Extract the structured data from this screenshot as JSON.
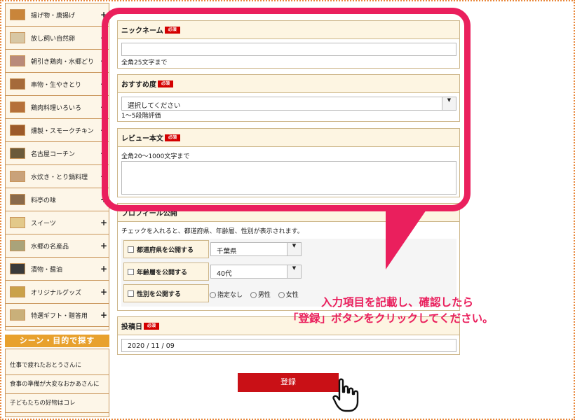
{
  "sidebar": {
    "categories": [
      {
        "label": "揚げ物・唐揚げ",
        "icon": "fried-chicken-thumb"
      },
      {
        "label": "放し飼い自然卵",
        "icon": "egg-thumb"
      },
      {
        "label": "朝引き鶏肉・水郷どり",
        "icon": "raw-chicken-thumb"
      },
      {
        "label": "串物・生やきとり",
        "icon": "skewer-thumb"
      },
      {
        "label": "鶏肉料理いろいろ",
        "icon": "chicken-dish-thumb"
      },
      {
        "label": "燻製・スモークチキン",
        "icon": "smoked-chicken-thumb"
      },
      {
        "label": "名古屋コーチン",
        "icon": "nagoya-cochin-thumb"
      },
      {
        "label": "水炊き・とり鍋料理",
        "icon": "hotpot-thumb"
      },
      {
        "label": "料亭の味",
        "icon": "ryotei-thumb"
      },
      {
        "label": "スイーツ",
        "icon": "sweets-thumb"
      },
      {
        "label": "水郷の名産品",
        "icon": "local-specialty-thumb"
      },
      {
        "label": "漬物・醤油",
        "icon": "pickles-thumb"
      },
      {
        "label": "オリジナルグッズ",
        "icon": "goods-thumb"
      },
      {
        "label": "特選ギフト・贈答用",
        "icon": "gift-thumb"
      }
    ],
    "scene_heading": "シーン・目的で探す",
    "scene_items": [
      "仕事で疲れたおとうさんに",
      "食事の準備が大変なおかあさんに",
      "子どもたちの好物はコレ"
    ]
  },
  "form": {
    "required_badge": "必須",
    "nickname": {
      "label": "ニックネーム",
      "value": "",
      "note": "全角25文字まで"
    },
    "rating": {
      "label": "おすすめ度",
      "selected": "選択してください",
      "note": "1～5段階評価"
    },
    "review": {
      "label": "レビュー本文",
      "note": "全角20～1000文字まで",
      "value": ""
    },
    "profile": {
      "label": "プロフィール公開",
      "description": "チェックを入れると、都道府県、年齢層、性別が表示されます。",
      "prefecture": {
        "label": "都道府県を公開する",
        "selected": "千葉県"
      },
      "age": {
        "label": "年齢層を公開する",
        "selected": "40代"
      },
      "gender": {
        "label": "性別を公開する",
        "options": [
          "指定なし",
          "男性",
          "女性"
        ]
      }
    },
    "post_date": {
      "label": "投稿日",
      "value": "2020 / 11 / 09"
    },
    "submit_label": "登録"
  },
  "annotation": {
    "line1": "入力項目を記載し、確認したら",
    "line2": "「登録」ボタンをクリックしてください。",
    "color": "#ea1f5d"
  }
}
